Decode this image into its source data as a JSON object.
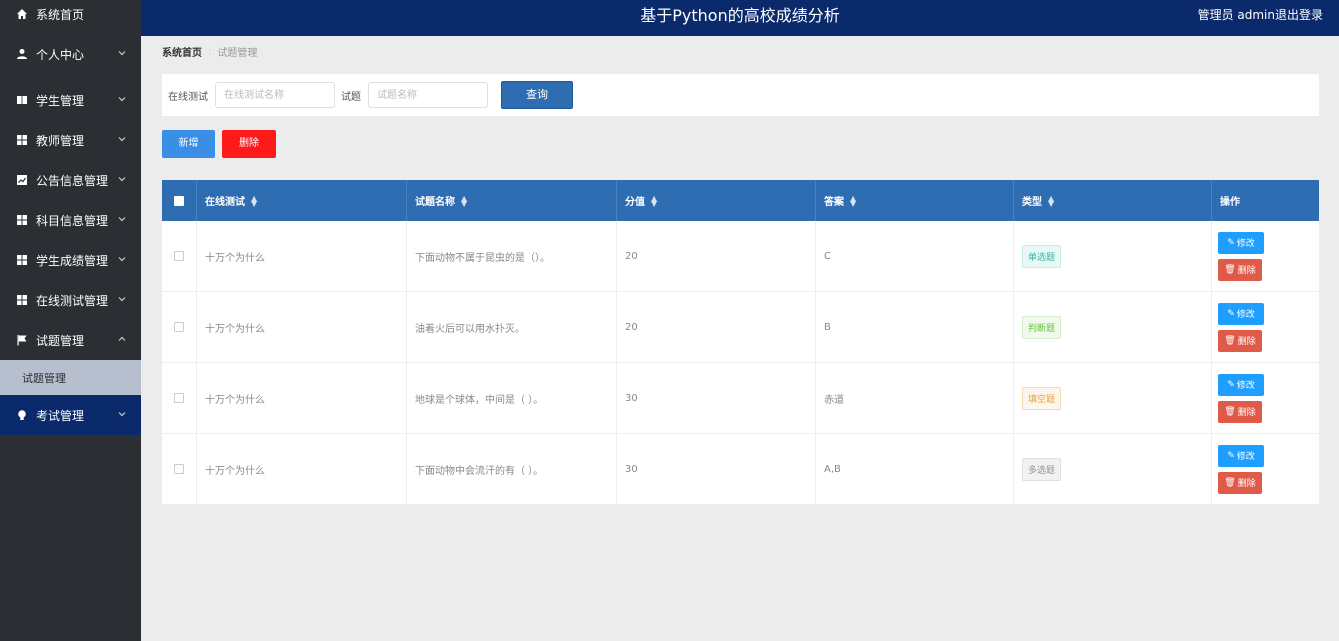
{
  "header": {
    "title": "基于Python的高校成绩分析",
    "user": "管理员 admin",
    "logout": "退出登录"
  },
  "sidebar": {
    "items": [
      {
        "label": "系统首页",
        "icon": "home-icon"
      },
      {
        "label": "个人中心",
        "icon": "user-icon"
      },
      {
        "label": "学生管理",
        "icon": "book-icon"
      },
      {
        "label": "教师管理",
        "icon": "grid-icon"
      },
      {
        "label": "公告信息管理",
        "icon": "chart-icon"
      },
      {
        "label": "科目信息管理",
        "icon": "grid-icon"
      },
      {
        "label": "学生成绩管理",
        "icon": "grid-icon"
      },
      {
        "label": "在线测试管理",
        "icon": "grid-icon"
      },
      {
        "label": "试题管理",
        "icon": "flag-icon"
      },
      {
        "label": "考试管理",
        "icon": "bulb-icon"
      }
    ],
    "submenu": {
      "label": "试题管理"
    }
  },
  "breadcrumb": {
    "home": "系统首页",
    "separator": ":",
    "current": "试题管理"
  },
  "search": {
    "test_label": "在线测试",
    "test_placeholder": "在线测试名称",
    "question_label": "试题",
    "question_placeholder": "试题名称",
    "query_button": "查询"
  },
  "actions": {
    "add": "新增",
    "delete": "删除"
  },
  "table": {
    "headers": [
      "在线测试",
      "试题名称",
      "分值",
      "答案",
      "类型",
      "操作"
    ],
    "rows": [
      {
        "test": "十万个为什么",
        "name": "下面动物不属于昆虫的是（）。",
        "score": "20",
        "answer": "C",
        "type": "单选题",
        "edit": "修改",
        "delete": "删除"
      },
      {
        "test": "十万个为什么",
        "name": "油着火后可以用水扑灭。",
        "score": "20",
        "answer": "B",
        "type": "判断题",
        "edit": "修改",
        "delete": "删除"
      },
      {
        "test": "十万个为什么",
        "name": "地球是个球体，中间是（ ）。",
        "score": "30",
        "answer": "赤道",
        "type": "填空题",
        "edit": "修改",
        "delete": "删除"
      },
      {
        "test": "十万个为什么",
        "name": "下面动物中会流汗的有（ ）。",
        "score": "30",
        "answer": "A,B",
        "type": "多选题",
        "edit": "修改",
        "delete": "删除"
      }
    ]
  },
  "colors": {
    "header_bg": "#0b2a6b",
    "sidebar_bg": "#2b2e33",
    "primary": "#2f6db3",
    "danger": "#ff1a1a"
  }
}
